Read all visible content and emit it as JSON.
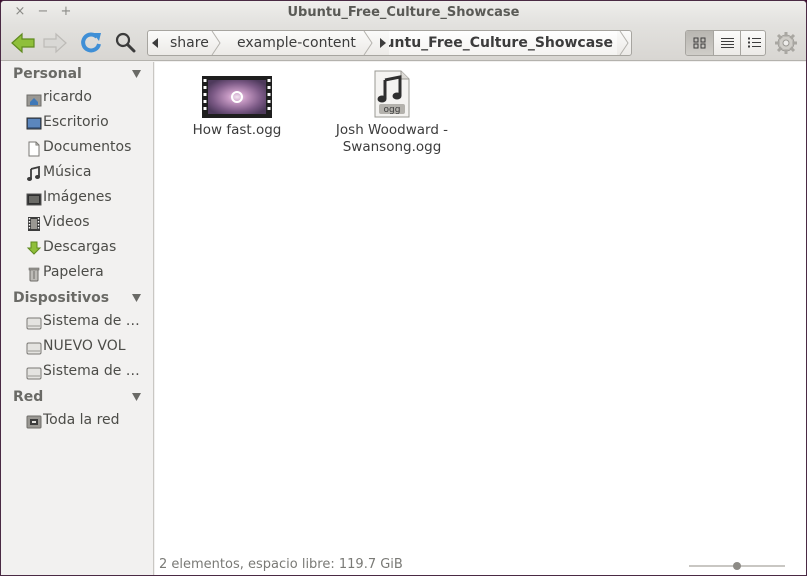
{
  "window": {
    "title": "Ubuntu_Free_Culture_Showcase",
    "close_glyph": "×",
    "minimize_glyph": "−",
    "maximize_glyph": "+"
  },
  "toolbar": {
    "back_icon": "back-arrow-icon",
    "forward_icon": "forward-arrow-icon",
    "reload_icon": "reload-icon",
    "search_icon": "search-icon",
    "breadcrumbs": [
      "share",
      "example-content",
      "Ubuntu_Free_Culture_Showcase"
    ],
    "view_icons": [
      "grid-view-icon",
      "list-view-icon",
      "compact-view-icon"
    ],
    "gear_icon": "gear-icon",
    "accent_color": "#7da52f"
  },
  "sidebar": {
    "sections": [
      {
        "title": "Personal",
        "items": [
          {
            "label": "ricardo",
            "icon": "home-folder-icon"
          },
          {
            "label": "Escritorio",
            "icon": "desktop-icon"
          },
          {
            "label": "Documentos",
            "icon": "documents-icon"
          },
          {
            "label": "Música",
            "icon": "music-icon"
          },
          {
            "label": "Imágenes",
            "icon": "pictures-icon"
          },
          {
            "label": "Videos",
            "icon": "videos-icon"
          },
          {
            "label": "Descargas",
            "icon": "downloads-icon"
          },
          {
            "label": "Papelera",
            "icon": "trash-icon"
          }
        ]
      },
      {
        "title": "Dispositivos",
        "items": [
          {
            "label": "Sistema de archivos",
            "icon": "drive-icon"
          },
          {
            "label": "NUEVO VOL",
            "icon": "drive-icon"
          },
          {
            "label": "Sistema de archivos",
            "icon": "drive-icon"
          }
        ]
      },
      {
        "title": "Red",
        "items": [
          {
            "label": "Toda la red",
            "icon": "network-icon"
          }
        ]
      }
    ]
  },
  "files": [
    {
      "name": "How fast.ogg",
      "type": "video-thumbnail"
    },
    {
      "name": "Josh Woodward - Swansong.ogg",
      "type": "audio-ogg",
      "icon_badge": "ogg"
    }
  ],
  "status": {
    "text": "2 elementos, espacio libre: 119.7 GiB",
    "zoom_level": 0.5
  }
}
